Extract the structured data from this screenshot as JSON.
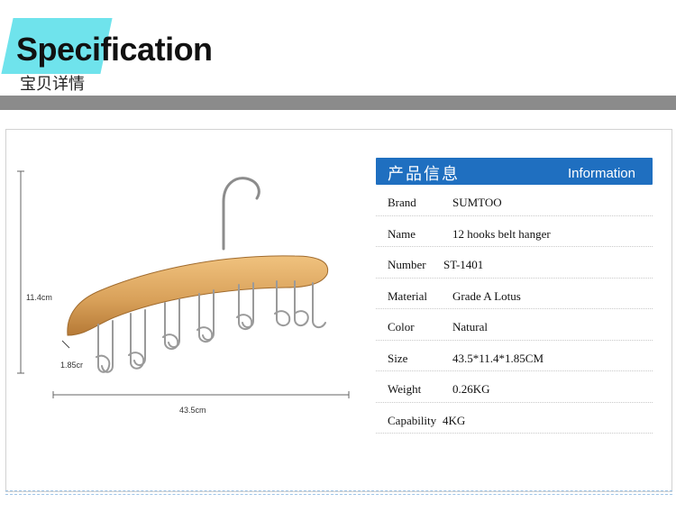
{
  "header": {
    "title": "Specification",
    "subtitle": "宝贝详情"
  },
  "dimensions": {
    "height": "11.4cm",
    "thickness": "1.85cr",
    "width": "43.5cm"
  },
  "spec": {
    "header_cn": "产品信息",
    "header_en": "Information",
    "rows": [
      {
        "label": "Brand",
        "value": "SUMTOO"
      },
      {
        "label": "Name",
        "value": "12 hooks belt hanger"
      },
      {
        "label": "Number",
        "value": "ST-1401"
      },
      {
        "label": "Material",
        "value": "Grade A Lotus"
      },
      {
        "label": "Color",
        "value": "Natural"
      },
      {
        "label": "Size",
        "value": "43.5*11.4*1.85CM"
      },
      {
        "label": "Weight",
        "value": "0.26KG"
      },
      {
        "label": "Capability",
        "value": "4KG"
      }
    ]
  },
  "colors": {
    "accent": "#6fe3ec",
    "band": "#8b8b8b",
    "spec_header": "#1f6fc0",
    "wood": "#d9a15a"
  }
}
